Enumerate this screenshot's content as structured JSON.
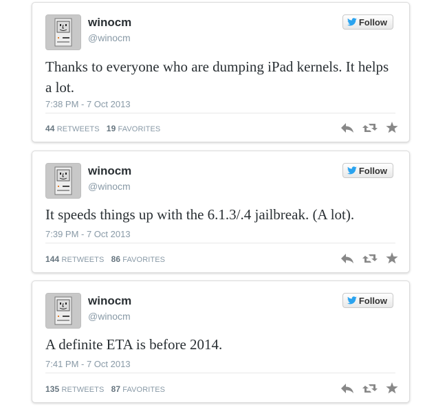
{
  "tweets": [
    {
      "name": "winocm",
      "handle": "@winocm",
      "follow_label": "Follow",
      "text": "Thanks to everyone who are dumping iPad kernels. It helps a lot.",
      "time": "7:38 PM - 7 Oct 2013",
      "retweets": "44",
      "retweets_label": "RETWEETS",
      "favorites": "19",
      "favorites_label": "FAVORITES"
    },
    {
      "name": "winocm",
      "handle": "@winocm",
      "follow_label": "Follow",
      "text": "It speeds things up with the 6.1.3/.4 jailbreak. (A lot).",
      "time": "7:39 PM - 7 Oct 2013",
      "retweets": "144",
      "retweets_label": "RETWEETS",
      "favorites": "86",
      "favorites_label": "FAVORITES"
    },
    {
      "name": "winocm",
      "handle": "@winocm",
      "follow_label": "Follow",
      "text": "A definite ETA is before 2014.",
      "time": "7:41 PM - 7 Oct 2013",
      "retweets": "135",
      "retweets_label": "RETWEETS",
      "favorites": "87",
      "favorites_label": "FAVORITES"
    }
  ],
  "icons": {
    "avatar": "classic-mac-face-icon",
    "follow": "twitter-bird-icon",
    "reply": "reply-icon",
    "retweet": "retweet-icon",
    "favorite": "star-icon"
  },
  "colors": {
    "bird": "#2aa3ef",
    "action_icon": "#888888",
    "meta_text": "#8899a6"
  }
}
